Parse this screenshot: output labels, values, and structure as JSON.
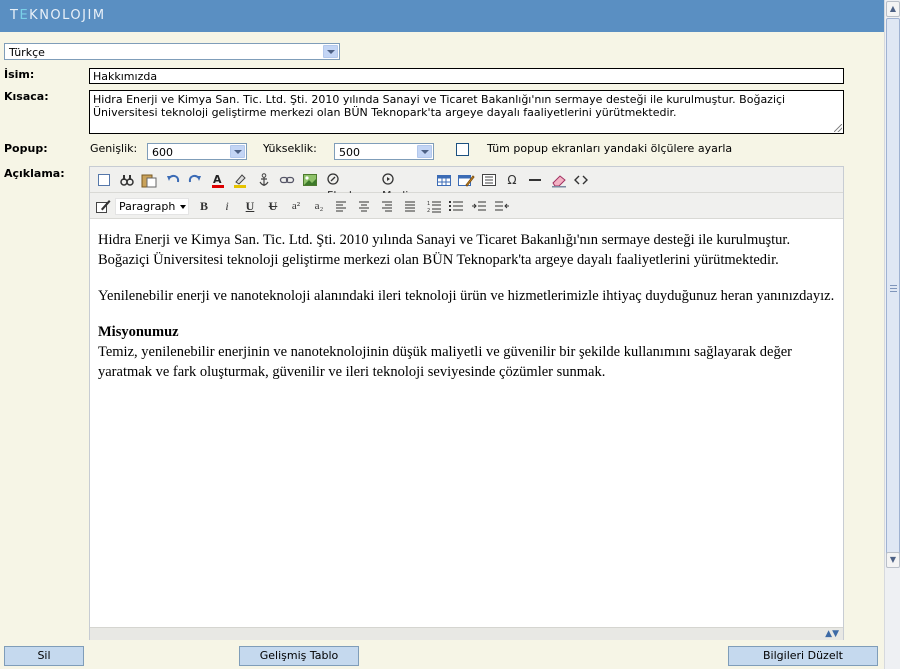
{
  "header": {
    "logo_prefix": "T",
    "logo_accent": "E",
    "logo_rest": "KNOLOJIM"
  },
  "language": {
    "selected": "Türkçe"
  },
  "form": {
    "name_label": "İsim:",
    "name_value": "Hakkımızda",
    "summary_label": "Kısaca:",
    "summary_value": "Hidra Enerji ve Kimya San. Tic. Ltd. Şti. 2010 yılında Sanayi ve Ticaret Bakanlığı'nın sermaye desteği ile kurulmuştur. Boğaziçi Üniversitesi teknoloji geliştirme merkezi olan BÜN Teknopark'ta argeye dayalı faaliyetlerini yürütmektedir.",
    "popup_label": "Popup:",
    "width_label": "Genişlik:",
    "width_value": "600",
    "height_label": "Yükseklik:",
    "height_value": "500",
    "popup_checkbox_label": "Tüm popup ekranları yandaki ölçülere ayarla",
    "description_label": "Açıklama:"
  },
  "editor": {
    "flash_label": "Flash",
    "media_label": "Media",
    "format_value": "Paragraph",
    "superscript": "a²",
    "subscript": "a₂",
    "paragraph1_line1": "Hidra Enerji ve Kimya San. Tic. Ltd. Şti. 2010 yılında Sanayi ve Ticaret Bakanlığı'nın sermaye desteği ile kurulmuştur.",
    "paragraph1_line2": "Boğaziçi Üniversitesi teknoloji geliştirme merkezi olan BÜN Teknopark'ta argeye dayalı faaliyetlerini yürütmektedir.",
    "paragraph2": "Yenilenebilir enerji ve nanoteknoloji alanındaki ileri teknoloji ürün ve hizmetlerimizle ihtiyaç duyduğunuz heran yanınızdayız.",
    "heading": "Misyonumuz",
    "paragraph3": "Temiz, yenilenebilir enerjinin ve nanoteknolojinin düşük maliyetli ve güvenilir bir şekilde kullanımını sağlayarak değer yaratmak ve fark oluşturmak, güvenilir ve ileri teknoloji seviyesinde çözümler sunmak."
  },
  "buttons": {
    "delete": "Sil",
    "advanced_table": "Gelişmiş Tablo",
    "save": "Bilgileri Düzelt"
  },
  "colors": {
    "header": "#5a8fc2",
    "page": "#f6f5e6",
    "button": "#c5d9ee"
  }
}
